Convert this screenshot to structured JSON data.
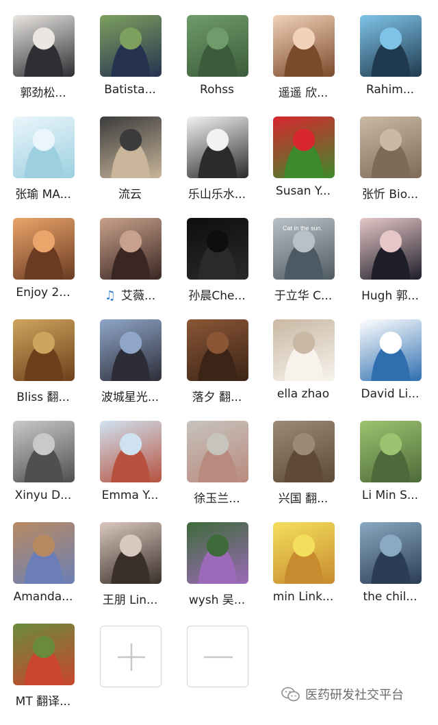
{
  "members": [
    {
      "name": "郭劲松...",
      "avatar": "person-man-glasses-photo",
      "bg": [
        "#e9e6e2",
        "#2e2e33"
      ]
    },
    {
      "name": "Batista...",
      "avatar": "person-man-outdoor-photo",
      "bg": [
        "#7da05f",
        "#253250"
      ]
    },
    {
      "name": "Rohss",
      "avatar": "forest-pavilion-photo",
      "bg": [
        "#6f9c6a",
        "#3b5b3a"
      ]
    },
    {
      "name": "遥遥 欣...",
      "avatar": "baby-sunglasses-photo",
      "bg": [
        "#f1d2b8",
        "#7b4a2c"
      ]
    },
    {
      "name": "Rahim...",
      "avatar": "sky-landscape-photo",
      "bg": [
        "#7fc4e8",
        "#1f3a4f"
      ]
    },
    {
      "name": "张瑜 MA...",
      "avatar": "fishbowl-cartoon",
      "bg": [
        "#eaf6fb",
        "#9ccfe0"
      ]
    },
    {
      "name": "流云",
      "avatar": "cat-in-tie-photo",
      "bg": [
        "#3b3b3b",
        "#c8b59a"
      ]
    },
    {
      "name": "乐山乐水...",
      "avatar": "man-profile-photo",
      "bg": [
        "#f2f2f2",
        "#2b2b2b"
      ]
    },
    {
      "name": "Susan Y...",
      "avatar": "strawberries-photo",
      "bg": [
        "#d8262e",
        "#3d8a2c"
      ]
    },
    {
      "name": "张忻 Bio...",
      "avatar": "kitten-photo",
      "bg": [
        "#c9b9a5",
        "#7d6a57"
      ]
    },
    {
      "name": "Enjoy 2...",
      "avatar": "woman-portrait-photo",
      "bg": [
        "#e9a56a",
        "#6a3a22"
      ]
    },
    {
      "name": "艾薇...",
      "avatar": "woman-smiling-photo",
      "bg": [
        "#c9a08b",
        "#3a2723"
      ],
      "note_icon": "♫"
    },
    {
      "name": "孙晨Che...",
      "avatar": "signature-art",
      "bg": [
        "#0e0e0e",
        "#2a2a2a"
      ]
    },
    {
      "name": "于立华 C...",
      "avatar": "cat-in-the-sun-photo",
      "bg": [
        "#b9c1c7",
        "#4e5a63"
      ],
      "avatar_caption": "Cat in the sun."
    },
    {
      "name": "Hugh 郭...",
      "avatar": "hand-watch-photo",
      "bg": [
        "#e6c7c7",
        "#1e1e2a"
      ]
    },
    {
      "name": "Bliss 翻...",
      "avatar": "manuscript-wings-image",
      "bg": [
        "#cfa45e",
        "#6e3f1a"
      ]
    },
    {
      "name": "波城星光...",
      "avatar": "couple-selfie-photo",
      "bg": [
        "#8fa6c9",
        "#2d2d38"
      ]
    },
    {
      "name": "落夕 翻...",
      "avatar": "cafe-interior-photo",
      "bg": [
        "#8a5636",
        "#3c2416"
      ]
    },
    {
      "name": "ella zhao",
      "avatar": "woman-beach-photo",
      "bg": [
        "#c9b8a3",
        "#f7f3ec"
      ]
    },
    {
      "name": "David Li...",
      "avatar": "cartoon-karate-figure",
      "bg": [
        "#ffffff",
        "#2f6fb0"
      ]
    },
    {
      "name": "Xinyu D...",
      "avatar": "stone-relief-image",
      "bg": [
        "#c9c9c9",
        "#4f4f4f"
      ]
    },
    {
      "name": "Emma Y...",
      "avatar": "seaside-people-photo",
      "bg": [
        "#cfe2f0",
        "#b7523f"
      ]
    },
    {
      "name": "徐玉兰...",
      "avatar": "magnolia-flowers-photo",
      "bg": [
        "#c7c3bd",
        "#b98a7e"
      ]
    },
    {
      "name": "兴国 翻...",
      "avatar": "lion-photo",
      "bg": [
        "#9a8a77",
        "#5e4a35"
      ]
    },
    {
      "name": "Li Min S...",
      "avatar": "child-playing-photo",
      "bg": [
        "#9cc36f",
        "#4d6b3a"
      ]
    },
    {
      "name": "Amanda...",
      "avatar": "canyon-photo",
      "bg": [
        "#b88a62",
        "#6b7fb6"
      ]
    },
    {
      "name": "王朋 Lin...",
      "avatar": "man-sunglasses-photo",
      "bg": [
        "#d9c8be",
        "#3a2f29"
      ]
    },
    {
      "name": "wysh 吴...",
      "avatar": "lotus-flower-photo",
      "bg": [
        "#3e6b3a",
        "#9c6ab9"
      ]
    },
    {
      "name": "min Link...",
      "avatar": "emoji-grid-image",
      "bg": [
        "#f4df5d",
        "#c78a2e"
      ]
    },
    {
      "name": "the chil...",
      "avatar": "sunset-sea-photo",
      "bg": [
        "#8aa9c2",
        "#2b3d55"
      ]
    },
    {
      "name": "MT 翻译...",
      "avatar": "autumn-leaves-photo",
      "bg": [
        "#6a8c3a",
        "#c9452c"
      ]
    }
  ],
  "actions": {
    "add_label": "+",
    "remove_label": "−"
  },
  "watermark": {
    "text": "医药研发社交平台",
    "icon": "wechat-icon"
  }
}
